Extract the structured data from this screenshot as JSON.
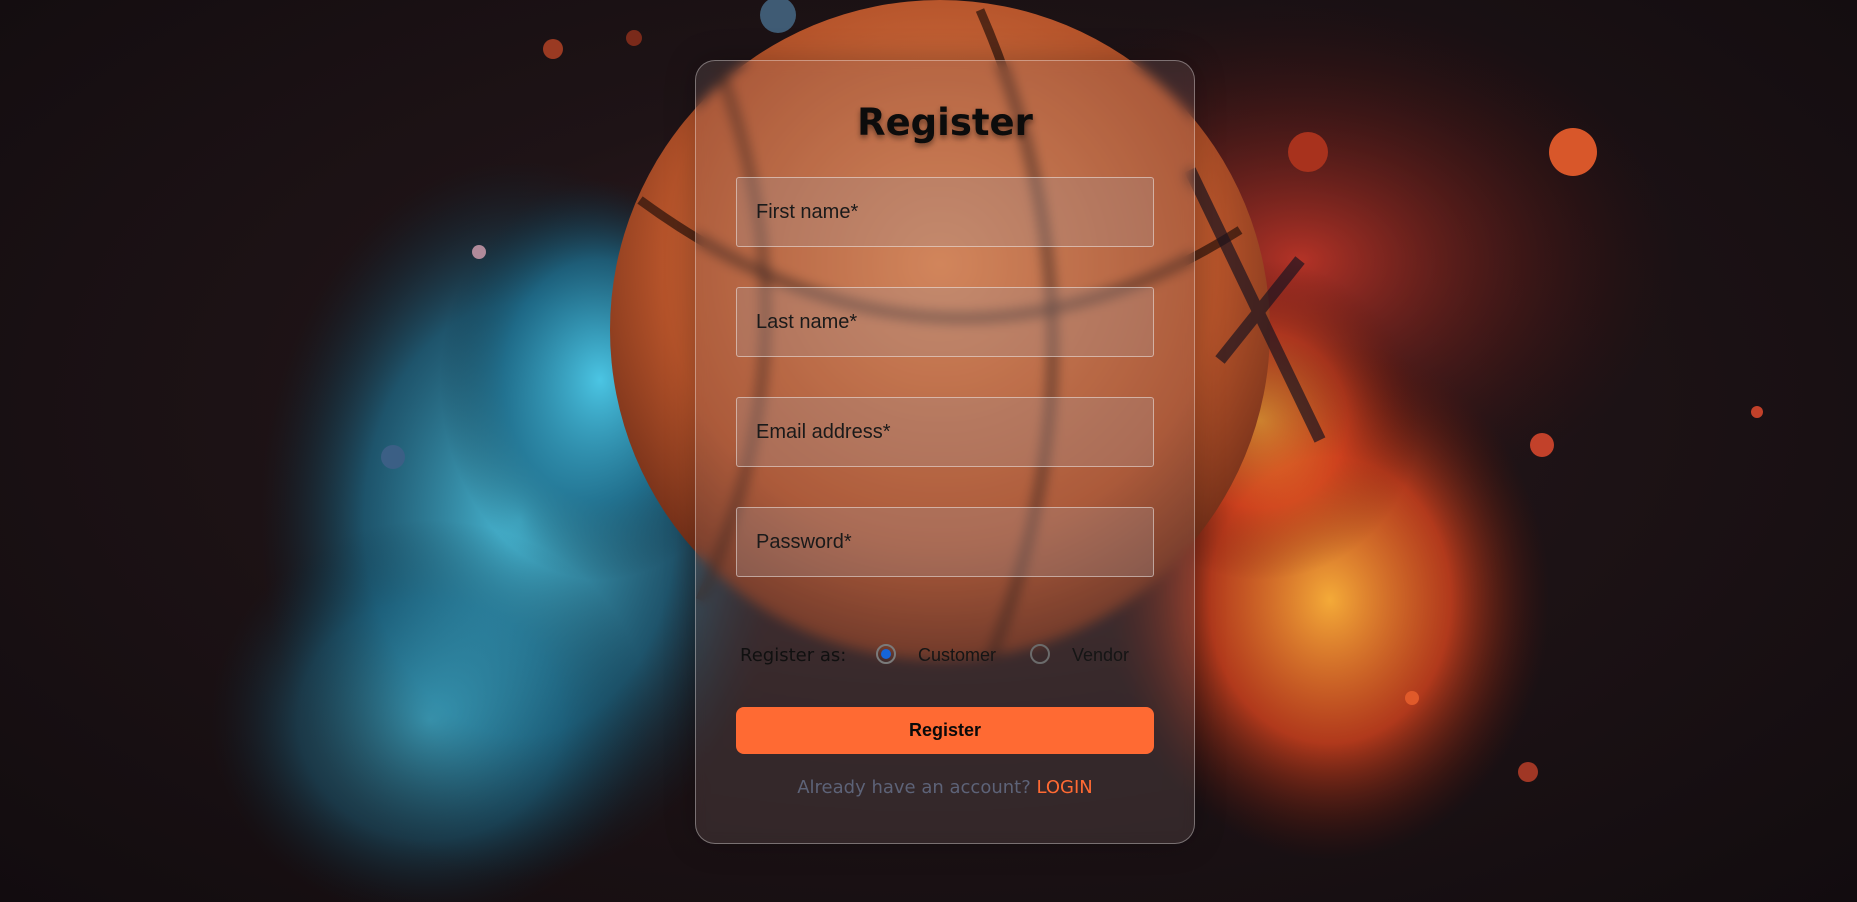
{
  "form": {
    "title": "Register",
    "fields": [
      {
        "placeholder": "First name*",
        "value": ""
      },
      {
        "placeholder": "Last name*",
        "value": ""
      },
      {
        "placeholder": "Email address*",
        "value": ""
      },
      {
        "placeholder": "Password*",
        "value": ""
      }
    ],
    "role": {
      "label": "Register as:",
      "options": [
        "Customer",
        "Vendor"
      ],
      "selected": "Customer"
    },
    "submit_label": "Register",
    "login_prompt": "Already have an account?",
    "login_label": "LOGIN"
  },
  "colors": {
    "accent": "#ff6a33",
    "radio_selected": "#1565d8",
    "prompt_text": "#5d6378"
  }
}
